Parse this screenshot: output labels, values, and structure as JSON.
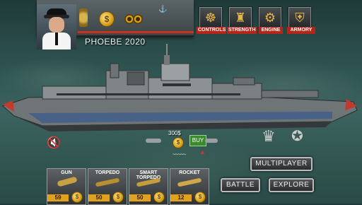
{
  "player": {
    "name": "PHOEBE 2020"
  },
  "top_menu": [
    {
      "label": "CONTROLS",
      "icon": "ship-wheel-icon"
    },
    {
      "label": "STRENGTH",
      "icon": "cannon-icon"
    },
    {
      "label": "ENGINE",
      "icon": "engine-icon"
    },
    {
      "label": "ARMORY",
      "icon": "shield-icon"
    }
  ],
  "shop": {
    "price": "300$",
    "buy_label": "BUY"
  },
  "buttons": {
    "multiplayer": "MULTIPLAYER",
    "battle": "BATTLE",
    "explore": "EXPLORE"
  },
  "weapons": [
    {
      "label": "GUN",
      "price": "59"
    },
    {
      "label": "TORPEDO",
      "price": "50"
    },
    {
      "label": "SMART TORPEDO",
      "price": "50"
    },
    {
      "label": "ROCKET",
      "price": "12"
    }
  ],
  "colors": {
    "accent_red": "#c8321e",
    "gold": "#e0a21c"
  }
}
